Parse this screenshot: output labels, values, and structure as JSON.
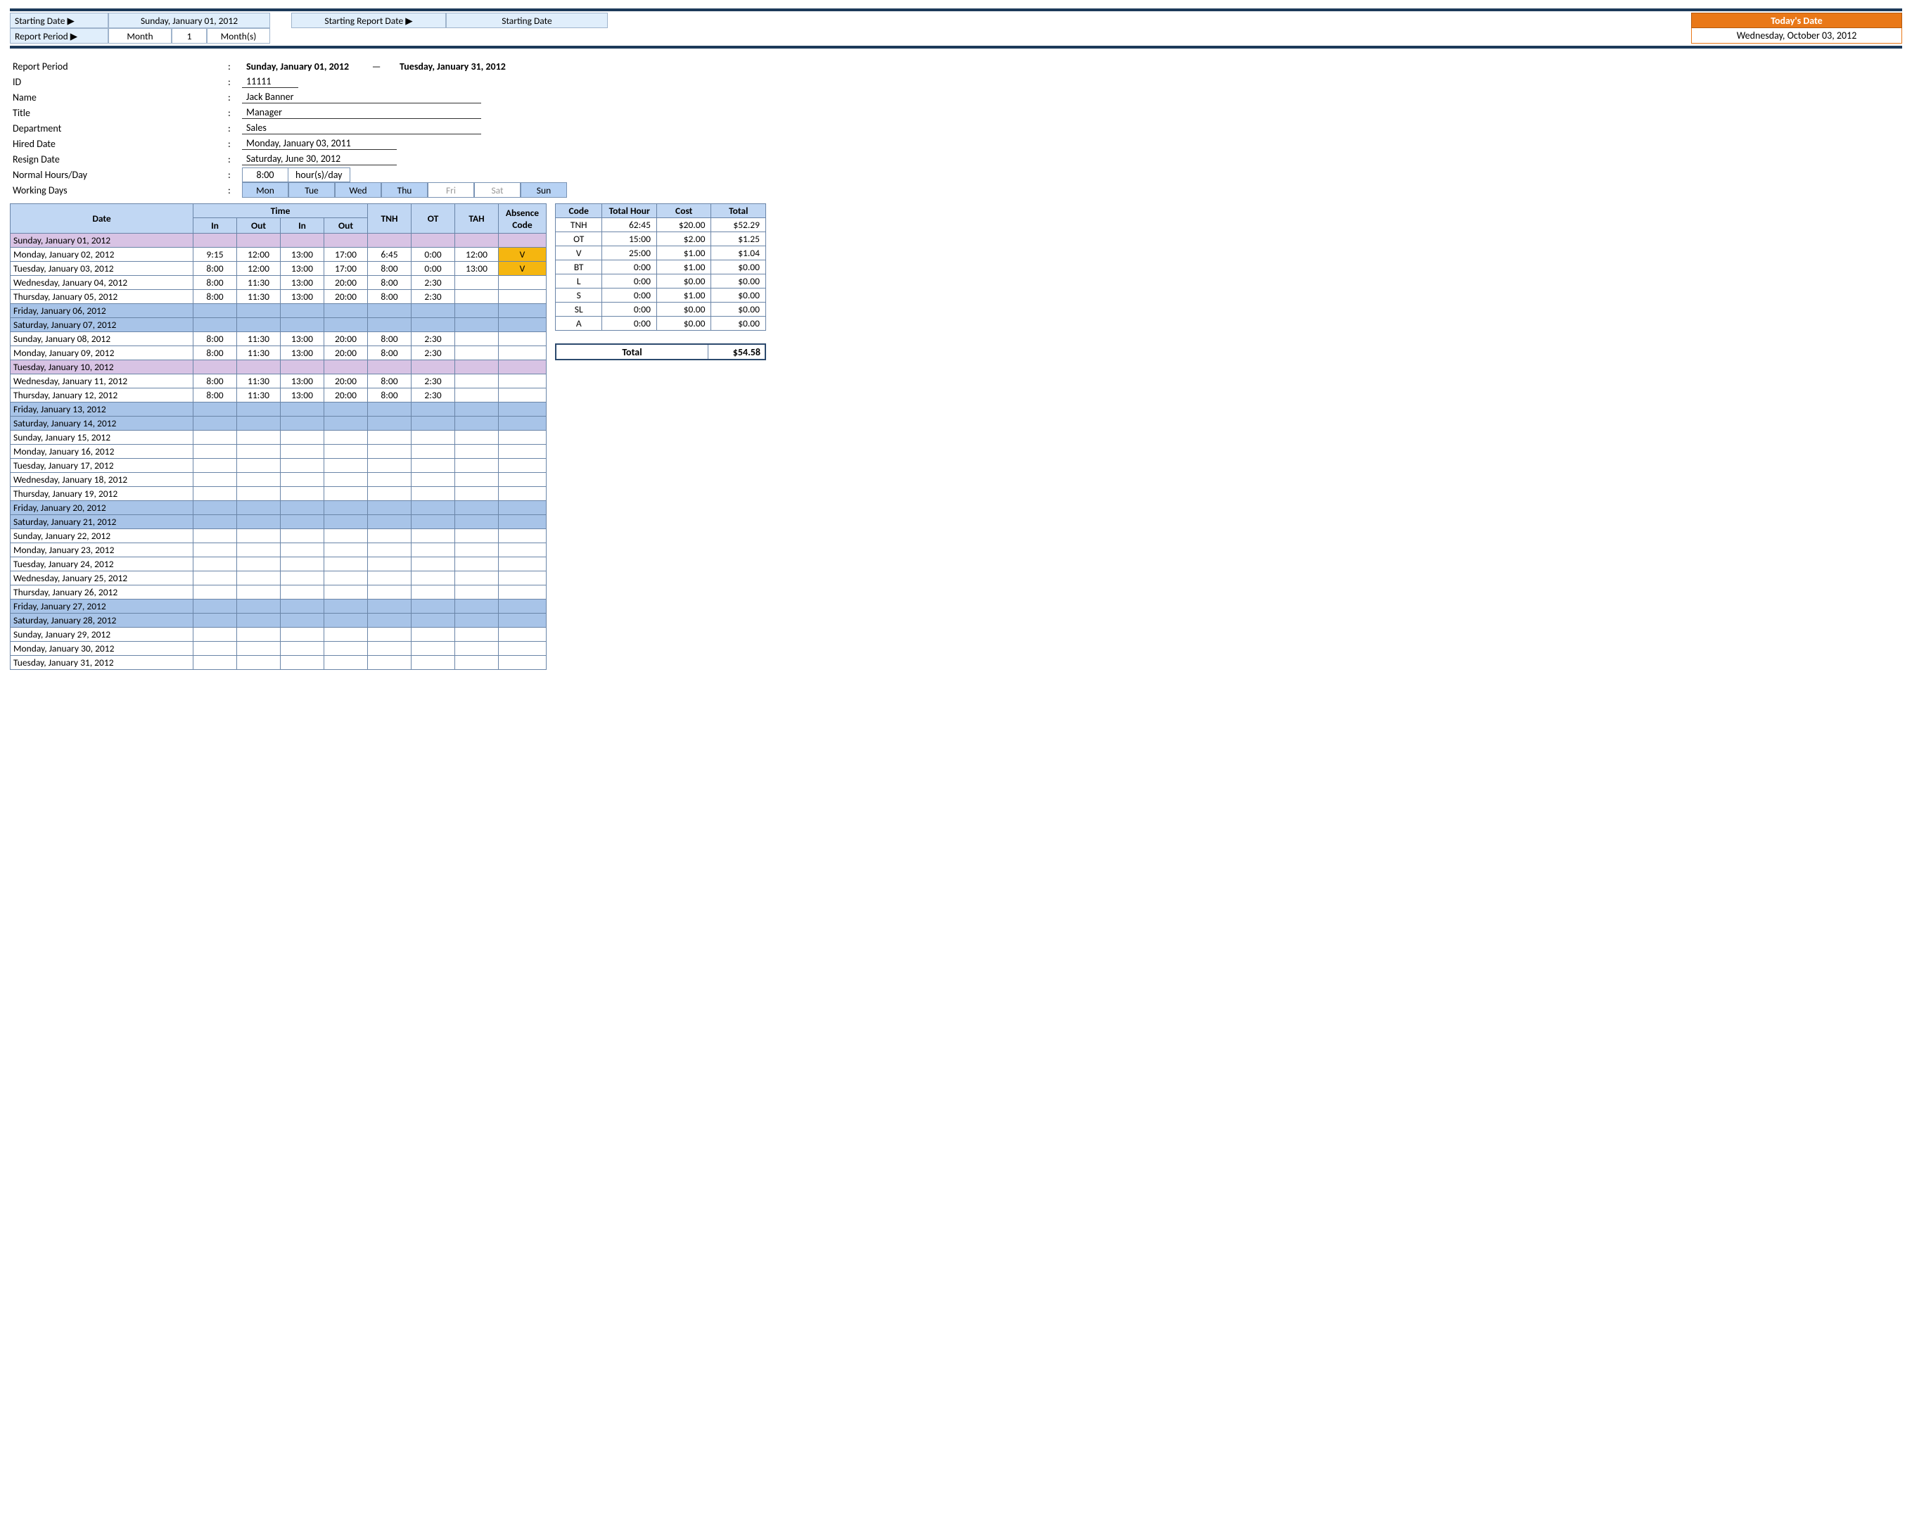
{
  "topbar": {
    "starting_date_label": "Starting Date ▶",
    "starting_date_value": "Sunday, January 01, 2012",
    "report_period_label": "Report Period ▶",
    "rp_unit_label": "Month",
    "rp_count": "1",
    "rp_unit_plural": "Month(s)",
    "starting_report_date_label": "Starting Report Date ▶",
    "starting_report_date_value": "Starting Date",
    "todays_date_label": "Today's Date",
    "todays_date_value": "Wednesday, October 03, 2012"
  },
  "info": {
    "report_period_label": "Report Period",
    "report_period_start": "Sunday, January 01, 2012",
    "report_period_end": "Tuesday, January 31, 2012",
    "id_label": "ID",
    "id_value": "11111",
    "name_label": "Name",
    "name_value": "Jack Banner",
    "title_label": "Title",
    "title_value": "Manager",
    "department_label": "Department",
    "department_value": "Sales",
    "hired_label": "Hired Date",
    "hired_value": "Monday, January 03, 2011",
    "resign_label": "Resign Date",
    "resign_value": "Saturday, June 30, 2012",
    "hours_label": "Normal Hours/Day",
    "hours_value": "8:00",
    "hours_unit": "hour(s)/day",
    "working_days_label": "Working Days",
    "days": [
      "Mon",
      "Tue",
      "Wed",
      "Thu",
      "Fri",
      "Sat",
      "Sun"
    ],
    "days_on": [
      true,
      true,
      true,
      true,
      false,
      false,
      true
    ]
  },
  "ts_headers": {
    "date": "Date",
    "time": "Time",
    "in": "In",
    "out": "Out",
    "tnh": "TNH",
    "ot": "OT",
    "tah": "TAH",
    "absence": "Absence Code"
  },
  "ts_rows": [
    {
      "date": "Sunday, January 01, 2012",
      "style": "pink"
    },
    {
      "date": "Monday, January 02, 2012",
      "in1": "9:15",
      "out1": "12:00",
      "in2": "13:00",
      "out2": "17:00",
      "tnh": "6:45",
      "ot": "0:00",
      "tah": "12:00",
      "abs": "V"
    },
    {
      "date": "Tuesday, January 03, 2012",
      "in1": "8:00",
      "out1": "12:00",
      "in2": "13:00",
      "out2": "17:00",
      "tnh": "8:00",
      "ot": "0:00",
      "tah": "13:00",
      "abs": "V"
    },
    {
      "date": "Wednesday, January 04, 2012",
      "in1": "8:00",
      "out1": "11:30",
      "in2": "13:00",
      "out2": "20:00",
      "tnh": "8:00",
      "ot": "2:30"
    },
    {
      "date": "Thursday, January 05, 2012",
      "in1": "8:00",
      "out1": "11:30",
      "in2": "13:00",
      "out2": "20:00",
      "tnh": "8:00",
      "ot": "2:30"
    },
    {
      "date": "Friday, January 06, 2012",
      "style": "shade"
    },
    {
      "date": "Saturday, January 07, 2012",
      "style": "shade"
    },
    {
      "date": "Sunday, January 08, 2012",
      "in1": "8:00",
      "out1": "11:30",
      "in2": "13:00",
      "out2": "20:00",
      "tnh": "8:00",
      "ot": "2:30"
    },
    {
      "date": "Monday, January 09, 2012",
      "in1": "8:00",
      "out1": "11:30",
      "in2": "13:00",
      "out2": "20:00",
      "tnh": "8:00",
      "ot": "2:30"
    },
    {
      "date": "Tuesday, January 10, 2012",
      "style": "pink"
    },
    {
      "date": "Wednesday, January 11, 2012",
      "in1": "8:00",
      "out1": "11:30",
      "in2": "13:00",
      "out2": "20:00",
      "tnh": "8:00",
      "ot": "2:30"
    },
    {
      "date": "Thursday, January 12, 2012",
      "in1": "8:00",
      "out1": "11:30",
      "in2": "13:00",
      "out2": "20:00",
      "tnh": "8:00",
      "ot": "2:30"
    },
    {
      "date": "Friday, January 13, 2012",
      "style": "shade"
    },
    {
      "date": "Saturday, January 14, 2012",
      "style": "shade"
    },
    {
      "date": "Sunday, January 15, 2012"
    },
    {
      "date": "Monday, January 16, 2012"
    },
    {
      "date": "Tuesday, January 17, 2012"
    },
    {
      "date": "Wednesday, January 18, 2012"
    },
    {
      "date": "Thursday, January 19, 2012"
    },
    {
      "date": "Friday, January 20, 2012",
      "style": "shade"
    },
    {
      "date": "Saturday, January 21, 2012",
      "style": "shade"
    },
    {
      "date": "Sunday, January 22, 2012"
    },
    {
      "date": "Monday, January 23, 2012"
    },
    {
      "date": "Tuesday, January 24, 2012"
    },
    {
      "date": "Wednesday, January 25, 2012"
    },
    {
      "date": "Thursday, January 26, 2012"
    },
    {
      "date": "Friday, January 27, 2012",
      "style": "shade"
    },
    {
      "date": "Saturday, January 28, 2012",
      "style": "shade"
    },
    {
      "date": "Sunday, January 29, 2012"
    },
    {
      "date": "Monday, January 30, 2012"
    },
    {
      "date": "Tuesday, January 31, 2012"
    }
  ],
  "summary_headers": {
    "code": "Code",
    "total_hour": "Total Hour",
    "cost": "Cost",
    "total": "Total"
  },
  "summary_rows": [
    {
      "code": "TNH",
      "th": "62:45",
      "cost": "$20.00",
      "tot": "$52.29"
    },
    {
      "code": "OT",
      "th": "15:00",
      "cost": "$2.00",
      "tot": "$1.25"
    },
    {
      "code": "V",
      "th": "25:00",
      "cost": "$1.00",
      "tot": "$1.04"
    },
    {
      "code": "BT",
      "th": "0:00",
      "cost": "$1.00",
      "tot": "$0.00"
    },
    {
      "code": "L",
      "th": "0:00",
      "cost": "$0.00",
      "tot": "$0.00"
    },
    {
      "code": "S",
      "th": "0:00",
      "cost": "$1.00",
      "tot": "$0.00"
    },
    {
      "code": "SL",
      "th": "0:00",
      "cost": "$0.00",
      "tot": "$0.00"
    },
    {
      "code": "A",
      "th": "0:00",
      "cost": "$0.00",
      "tot": "$0.00"
    }
  ],
  "grand": {
    "label": "Total",
    "value": "$54.58"
  }
}
